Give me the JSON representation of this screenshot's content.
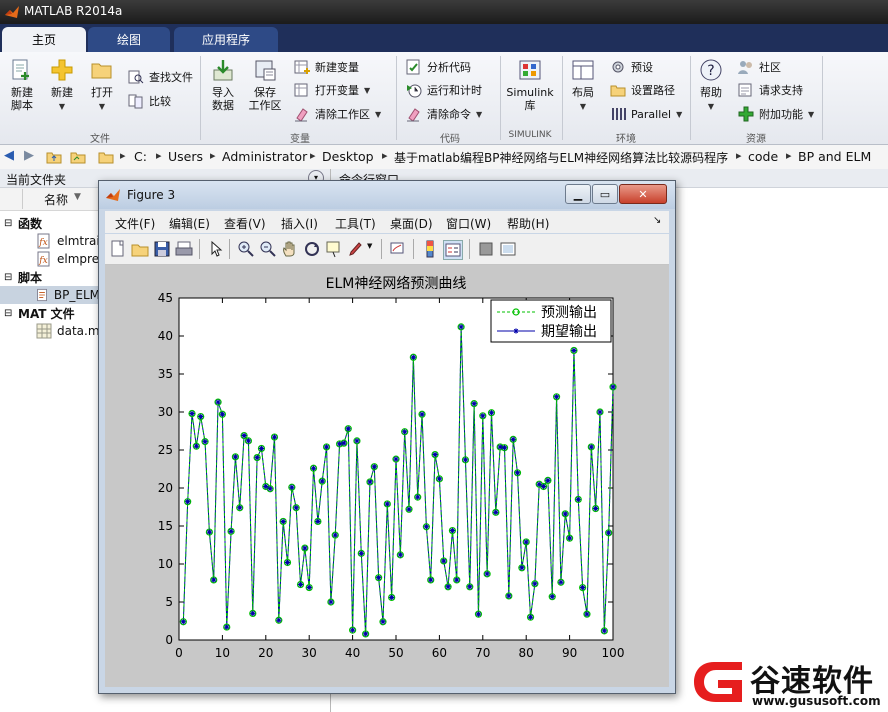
{
  "window": {
    "title": "MATLAB R2014a"
  },
  "tabs": [
    {
      "label": "主页",
      "active": true
    },
    {
      "label": "绘图",
      "active": false
    },
    {
      "label": "应用程序",
      "active": false
    }
  ],
  "ribbon": {
    "file": {
      "new_script": "新建\n脚本",
      "new": "新建",
      "open": "打开",
      "find_files": "查找文件",
      "compare": "比较",
      "group": "文件"
    },
    "variable": {
      "import": "导入\n数据",
      "save_ws": "保存\n工作区",
      "new_var": "新建变量",
      "open_var": "打开变量",
      "clear_ws": "清除工作区",
      "group": "变量"
    },
    "code": {
      "analyze": "分析代码",
      "run_time": "运行和计时",
      "clear_cmd": "清除命令",
      "group": "代码"
    },
    "simulink": {
      "label": "Simulink\n库",
      "group": "SIMULINK"
    },
    "env": {
      "layout": "布局",
      "prefs": "预设",
      "set_path": "设置路径",
      "parallel": "Parallel",
      "group": "环境"
    },
    "resources": {
      "help": "帮助",
      "community": "社区",
      "support": "请求支持",
      "addons": "附加功能",
      "group": "资源"
    }
  },
  "address": {
    "segments": [
      "C:",
      "Users",
      "Administrator",
      "Desktop",
      "基于matlab编程BP神经网络与ELM神经网络算法比较源码程序",
      "code",
      "BP and ELM"
    ]
  },
  "left_panel": {
    "title": "当前文件夹",
    "col_name": "名称",
    "groups": [
      {
        "label": "函数",
        "items": [
          "elmtrai",
          "elmpre"
        ]
      },
      {
        "label": "脚本",
        "items": [
          "BP_ELM"
        ]
      },
      {
        "label": "MAT 文件",
        "items": [
          "data.m"
        ]
      }
    ]
  },
  "right_panel": {
    "title": "命令行窗口"
  },
  "figure": {
    "title": "Figure 3",
    "menu": [
      "文件(F)",
      "编辑(E)",
      "查看(V)",
      "插入(I)",
      "工具(T)",
      "桌面(D)",
      "窗口(W)",
      "帮助(H)"
    ]
  },
  "watermark": {
    "brand": "谷速软件",
    "url": "www.gususoft.com"
  },
  "chart_data": {
    "type": "line",
    "title": "ELM神经网络预测曲线",
    "xlabel": "",
    "ylabel": "",
    "xlim": [
      0,
      100
    ],
    "ylim": [
      0,
      45
    ],
    "xticks": [
      0,
      10,
      20,
      30,
      40,
      50,
      60,
      70,
      80,
      90,
      100
    ],
    "yticks": [
      0,
      5,
      10,
      15,
      20,
      25,
      30,
      35,
      40,
      45
    ],
    "grid": false,
    "legend_position": "top-right",
    "colors": {
      "predicted": "#00c000",
      "expected": "#0000aa"
    },
    "series": [
      {
        "name": "预测输出",
        "style": "dashed-circle",
        "values": [
          2.4,
          18.2,
          29.8,
          25.5,
          29.4,
          26.1,
          14.2,
          7.9,
          31.3,
          29.7,
          1.7,
          14.3,
          24.1,
          17.4,
          26.9,
          26.2,
          3.5,
          24.0,
          25.2,
          20.2,
          19.9,
          26.7,
          2.6,
          15.6,
          10.2,
          20.1,
          17.4,
          7.3,
          12.1,
          6.9,
          22.6,
          15.6,
          20.9,
          25.4,
          5.0,
          13.8,
          25.8,
          25.9,
          27.8,
          1.3,
          26.2,
          11.4,
          0.8,
          20.8,
          22.8,
          8.2,
          2.4,
          17.9,
          5.6,
          23.8,
          11.2,
          27.4,
          17.2,
          37.2,
          18.8,
          29.7,
          14.9,
          7.9,
          24.4,
          21.2,
          10.4,
          7.0,
          14.4,
          7.9,
          41.2,
          23.7,
          7.0,
          31.1,
          3.4,
          29.5,
          8.7,
          29.9,
          16.8,
          25.4,
          25.3,
          5.8,
          26.4,
          22.0,
          9.5,
          12.9,
          3.0,
          7.4,
          20.5,
          20.2,
          21.0,
          5.7,
          32.0,
          7.6,
          16.6,
          13.4,
          38.1,
          18.5,
          6.9,
          3.4,
          25.4,
          17.3,
          30.0,
          1.2,
          14.1,
          33.3
        ]
      },
      {
        "name": "期望输出",
        "style": "solid-star",
        "values": [
          2.4,
          18.2,
          29.8,
          25.5,
          29.4,
          26.1,
          14.2,
          7.9,
          31.3,
          29.7,
          1.7,
          14.3,
          24.1,
          17.4,
          26.9,
          26.2,
          3.5,
          24.0,
          25.2,
          20.2,
          19.9,
          26.7,
          2.6,
          15.6,
          10.2,
          20.1,
          17.4,
          7.3,
          12.1,
          6.9,
          22.6,
          15.6,
          20.9,
          25.4,
          5.0,
          13.8,
          25.8,
          25.9,
          27.8,
          1.3,
          26.2,
          11.4,
          0.8,
          20.8,
          22.8,
          8.2,
          2.4,
          17.9,
          5.6,
          23.8,
          11.2,
          27.4,
          17.2,
          37.2,
          18.8,
          29.7,
          14.9,
          7.9,
          24.4,
          21.2,
          10.4,
          7.0,
          14.4,
          7.9,
          41.2,
          23.7,
          7.0,
          31.1,
          3.4,
          29.5,
          8.7,
          29.9,
          16.8,
          25.4,
          25.3,
          5.8,
          26.4,
          22.0,
          9.5,
          12.9,
          3.0,
          7.4,
          20.5,
          20.2,
          21.0,
          5.7,
          32.0,
          7.6,
          16.6,
          13.4,
          38.1,
          18.5,
          6.9,
          3.4,
          25.4,
          17.3,
          30.0,
          1.2,
          14.1,
          33.3
        ]
      }
    ]
  }
}
